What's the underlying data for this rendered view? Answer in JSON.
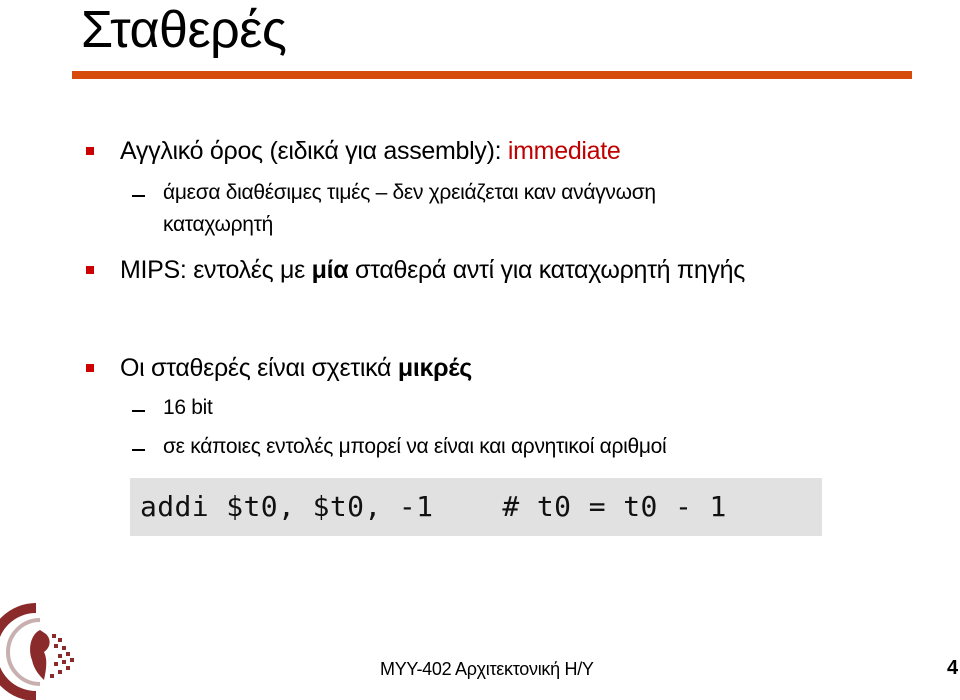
{
  "slide": {
    "title": "Σταθερές",
    "accent_color": "#d64a0a",
    "highlight_color": "#c00000",
    "bullets": [
      {
        "text_prefix": "Αγγλικό όρος (ειδικά για assembly): ",
        "text_highlight": "immediate",
        "sub_items": [
          {
            "line1": "άμεσα διαθέσιμες τιμές – δεν χρειάζεται καν ανάγνωση",
            "line2": "καταχωρητή"
          }
        ]
      },
      {
        "text_prefix": "MIPS: εντολές με ",
        "text_bold": "μία",
        "text_suffix": " σταθερά αντί για καταχωρητή πηγής"
      },
      {
        "text_prefix": "Οι σταθερές είναι σχετικά ",
        "text_bold": "μικρές",
        "sub_items": [
          {
            "line1": "16 bit"
          },
          {
            "line1": "σε κάποιες εντολές μπορεί να είναι και αρνητικοί αριθμοί"
          }
        ]
      }
    ],
    "code_example": "addi $t0, $t0, -1    # t0 = t0 - 1"
  },
  "footer": {
    "course": "ΜΥΥ-402 Αρχιτεκτονική Η/Υ",
    "page_number": "4",
    "logo": "university-seal-logo"
  }
}
